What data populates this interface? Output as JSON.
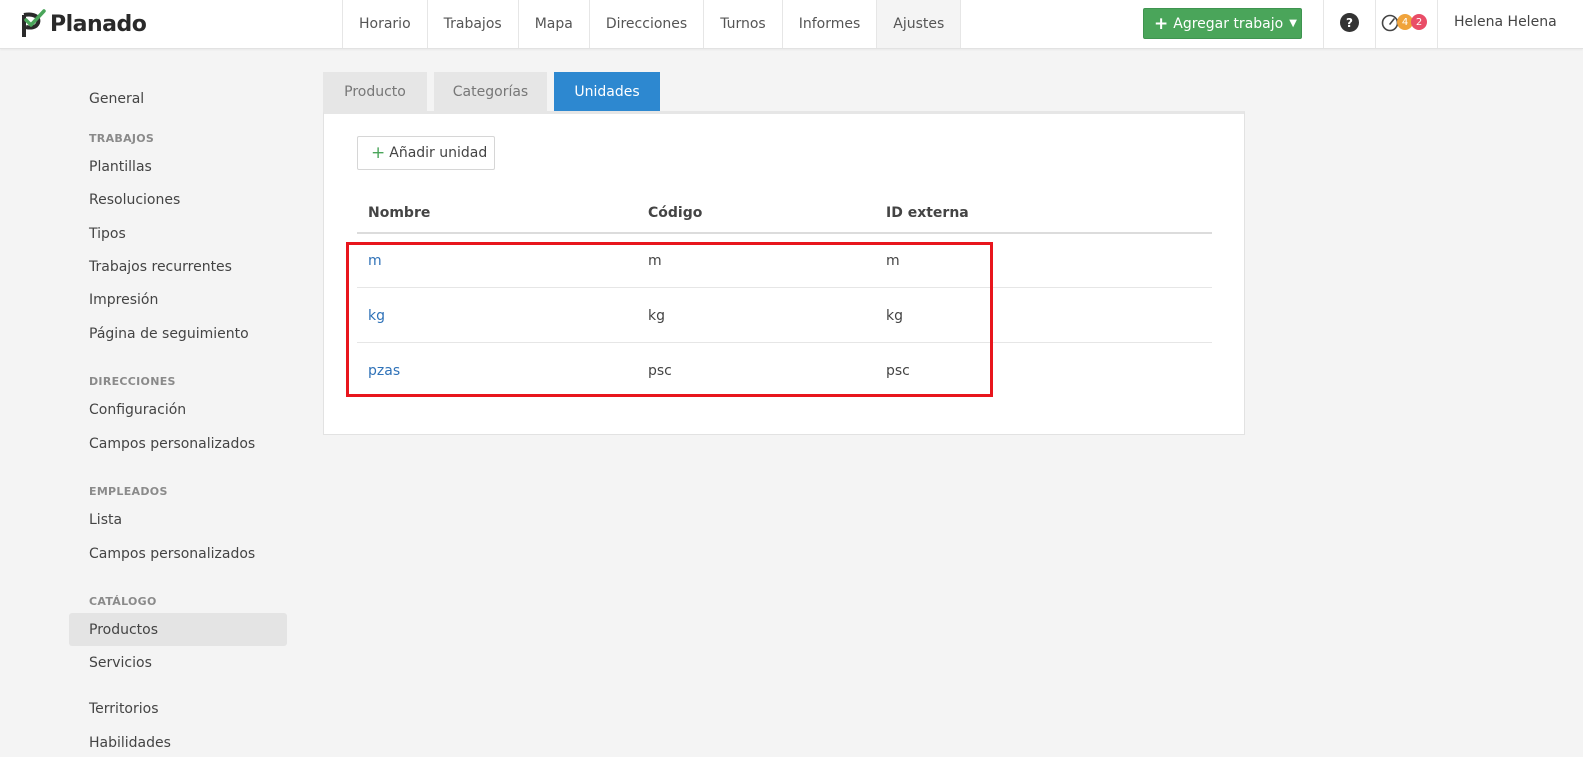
{
  "header": {
    "brand": "Planado",
    "nav": [
      "Horario",
      "Trabajos",
      "Mapa",
      "Direcciones",
      "Turnos",
      "Informes",
      "Ajustes"
    ],
    "active_nav": "Ajustes",
    "add_button_label": "Agregar trabajo",
    "help_label": "?",
    "badge_warnings": "4",
    "badge_alerts": "2",
    "user_name": "Helena Helena"
  },
  "sidebar": {
    "general": "General",
    "trabajos_heading": "TRABAJOS",
    "trabajos_items": [
      "Plantillas",
      "Resoluciones",
      "Tipos",
      "Trabajos recurrentes",
      "Impresión",
      "Página de seguimiento"
    ],
    "direcciones_heading": "DIRECCIONES",
    "direcciones_items": [
      "Configuración",
      "Campos personalizados"
    ],
    "empleados_heading": "EMPLEADOS",
    "empleados_items": [
      "Lista",
      "Campos personalizados"
    ],
    "catalogo_heading": "CATÁLOGO",
    "catalogo_items": [
      "Productos",
      "Servicios"
    ],
    "extra_items": [
      "Territorios",
      "Habilidades"
    ],
    "active_item": "Productos"
  },
  "tabs": [
    "Producto",
    "Categorías",
    "Unidades"
  ],
  "active_tab": "Unidades",
  "panel": {
    "add_unit_label": "Añadir unidad",
    "columns": [
      "Nombre",
      "Código",
      "ID externa"
    ],
    "rows": [
      [
        "m",
        "m",
        "m"
      ],
      [
        "kg",
        "kg",
        "kg"
      ],
      [
        "pzas",
        "psc",
        "psc"
      ]
    ]
  },
  "colors": {
    "brand_green": "#4aa55a",
    "active_tab_blue": "#2d88d0",
    "link_blue": "#2f72b8",
    "highlight_red": "#e8151d"
  }
}
